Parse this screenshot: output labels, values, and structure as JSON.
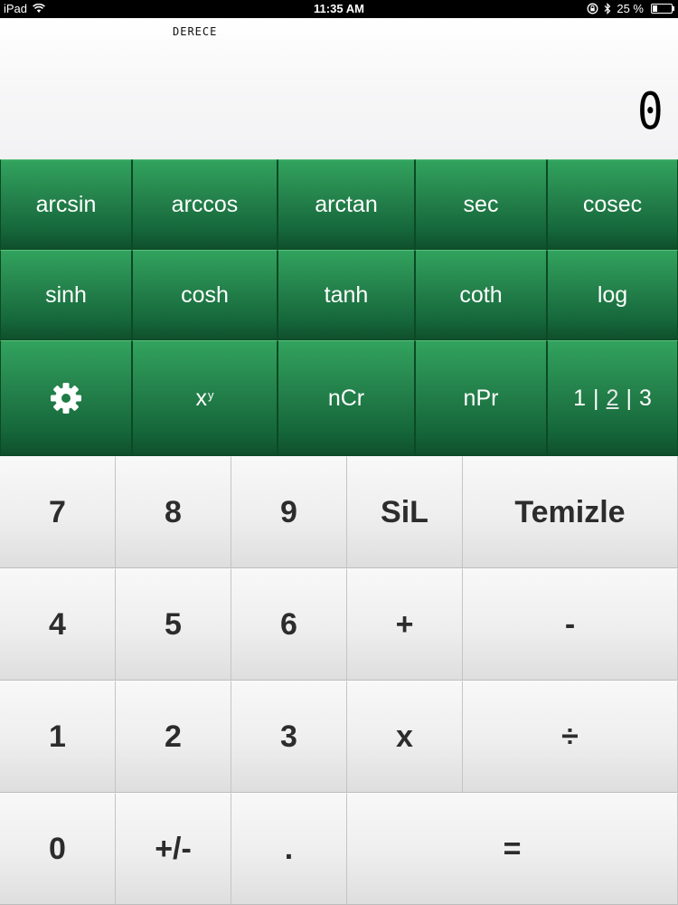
{
  "status_bar": {
    "device": "iPad",
    "time": "11:35 AM",
    "battery": "25 %",
    "battery_level": 0.25
  },
  "display": {
    "mode": "DERECE",
    "value": "0"
  },
  "function_keys": {
    "arcsin": "arcsin",
    "arccos": "arccos",
    "arctan": "arctan",
    "sec": "sec",
    "cosec": "cosec",
    "sinh": "sinh",
    "cosh": "cosh",
    "tanh": "tanh",
    "coth": "coth",
    "log": "log",
    "power_base": "x",
    "power_exp": "y",
    "ncr": "nCr",
    "npr": "nPr",
    "page_1": "1",
    "page_2": "2",
    "page_3": "3",
    "page_separator": "|"
  },
  "keypad": {
    "k7": "7",
    "k8": "8",
    "k9": "9",
    "delete": "SiL",
    "clear": "Temizle",
    "k4": "4",
    "k5": "5",
    "k6": "6",
    "plus": "+",
    "minus": "-",
    "k1": "1",
    "k2": "2",
    "k3": "3",
    "multiply": "x",
    "divide": "÷",
    "k0": "0",
    "sign": "+/-",
    "decimal": ".",
    "equals": "="
  },
  "icons": {
    "settings": "gear-icon",
    "wifi": "wifi-icon",
    "rotation_lock": "rotation-lock-icon",
    "bluetooth": "bluetooth-icon"
  },
  "colors": {
    "green_key": "#23804a",
    "key_text": "#2c2c2c"
  }
}
